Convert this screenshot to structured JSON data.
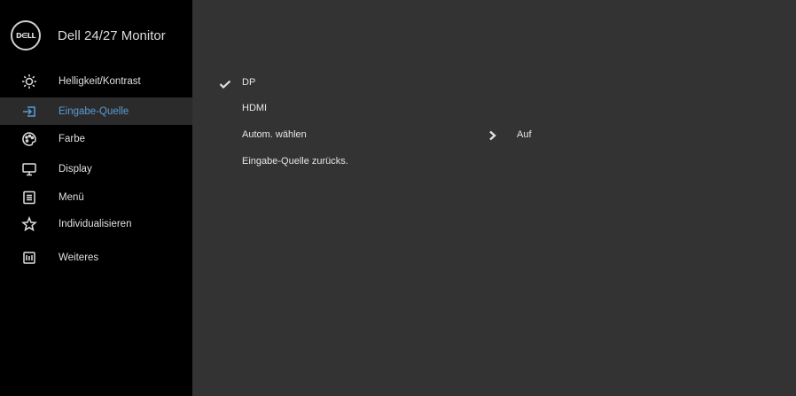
{
  "header": {
    "logo_text": "D∈LL",
    "title": "Dell 24/27 Monitor"
  },
  "sidebar": {
    "items": [
      {
        "label": "Helligkeit/Kontrast",
        "icon": "brightness-icon"
      },
      {
        "label": "Eingabe-Quelle",
        "icon": "input-source-icon",
        "active": true
      },
      {
        "label": "Farbe",
        "icon": "color-palette-icon"
      },
      {
        "label": "Display",
        "icon": "display-icon"
      },
      {
        "label": "Menü",
        "icon": "menu-icon"
      },
      {
        "label": "Individualisieren",
        "icon": "star-icon"
      },
      {
        "label": "Weiteres",
        "icon": "others-icon"
      }
    ]
  },
  "main": {
    "options": [
      {
        "label": "DP",
        "selected": true
      },
      {
        "label": "HDMI"
      },
      {
        "label": "Autom. wählen",
        "value": "Auf"
      },
      {
        "label": "Eingabe-Quelle zurücks."
      }
    ]
  },
  "colors": {
    "accent": "#5b9bd5",
    "sidebar_bg": "#000000",
    "panel_bg": "#333333"
  }
}
